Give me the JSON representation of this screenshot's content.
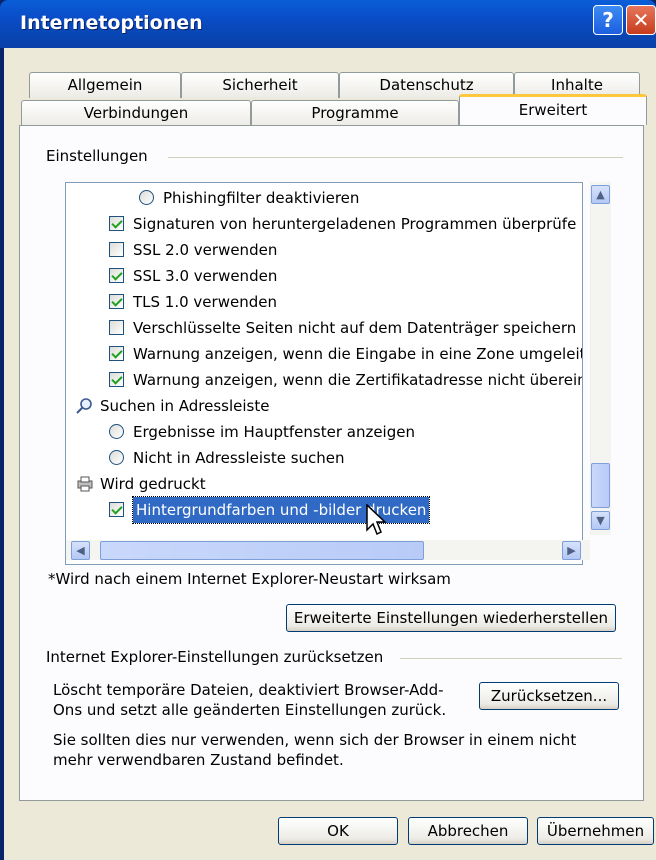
{
  "window": {
    "title": "Internetoptionen"
  },
  "tabs_row1": [
    "Allgemein",
    "Sicherheit",
    "Datenschutz",
    "Inhalte"
  ],
  "tabs_row2": [
    "Verbindungen",
    "Programme",
    "Erweitert"
  ],
  "active_tab": "Erweitert",
  "settings_group": {
    "label": "Einstellungen"
  },
  "list_items": [
    {
      "type": "radio",
      "checked": false,
      "indent": 1,
      "label": "Phishingfilter deaktivieren"
    },
    {
      "type": "checkbox",
      "checked": true,
      "indent": 0,
      "label": "Signaturen von heruntergeladenen Programmen überprüfe"
    },
    {
      "type": "checkbox",
      "checked": false,
      "indent": 0,
      "label": "SSL 2.0 verwenden"
    },
    {
      "type": "checkbox",
      "checked": true,
      "indent": 0,
      "label": "SSL 3.0 verwenden"
    },
    {
      "type": "checkbox",
      "checked": true,
      "indent": 0,
      "label": "TLS 1.0 verwenden"
    },
    {
      "type": "checkbox",
      "checked": false,
      "indent": 0,
      "label": "Verschlüsselte Seiten nicht auf dem Datenträger speichern"
    },
    {
      "type": "checkbox",
      "checked": true,
      "indent": 0,
      "label": "Warnung anzeigen, wenn die Eingabe in eine Zone umgeleitet wird"
    },
    {
      "type": "checkbox",
      "checked": true,
      "indent": 0,
      "label": "Warnung anzeigen, wenn die Zertifikatadresse nicht übereinstimmt"
    },
    {
      "type": "category",
      "icon": "search-icon",
      "label": "Suchen in Adressleiste"
    },
    {
      "type": "radio",
      "checked": false,
      "indent": 0,
      "label": "Ergebnisse im Hauptfenster anzeigen"
    },
    {
      "type": "radio",
      "checked": false,
      "indent": 0,
      "label": "Nicht in Adressleiste suchen"
    },
    {
      "type": "category",
      "icon": "printer-icon",
      "label": "Wird gedruckt"
    },
    {
      "type": "checkbox",
      "checked": true,
      "indent": 0,
      "label": "Hintergrundfarben und -bilder drucken",
      "selected": true
    }
  ],
  "restart_note": "*Wird nach einem Internet Explorer-Neustart wirksam",
  "restore_button": "Erweiterte Einstellungen wiederherstellen",
  "reset_group": {
    "label": "Internet Explorer-Einstellungen zurücksetzen",
    "description": "Löscht temporäre Dateien, deaktiviert Browser-Add-Ons und setzt alle geänderten Einstellungen zurück.",
    "button": "Zurücksetzen...",
    "warning": "Sie sollten dies nur verwenden, wenn sich der Browser in einem nicht mehr verwendbaren Zustand befindet."
  },
  "footer": {
    "ok": "OK",
    "cancel": "Abbrechen",
    "apply": "Übernehmen"
  },
  "colors": {
    "title_bar": "#0a4bc6",
    "dialog_bg": "#ece9d8",
    "selection": "#316ac5",
    "active_tab_accent": "#ffc83c"
  }
}
